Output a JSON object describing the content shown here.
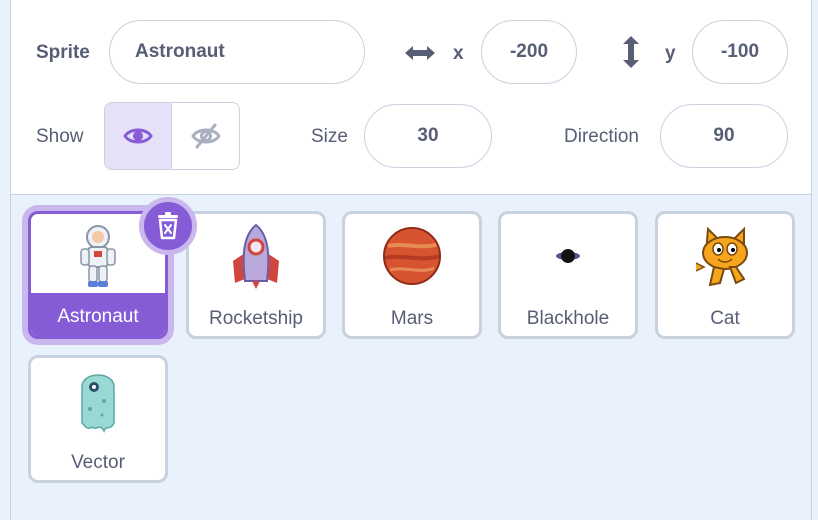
{
  "sprite_info": {
    "sprite_label": "Sprite",
    "sprite_name": "Astronaut",
    "x_label": "x",
    "x_value": "-200",
    "y_label": "y",
    "y_value": "-100",
    "show_label": "Show",
    "show_visible": true,
    "size_label": "Size",
    "size_value": "30",
    "direction_label": "Direction",
    "direction_value": "90"
  },
  "sprites": [
    {
      "name": "Astronaut",
      "selected": true,
      "icon": "astronaut-icon"
    },
    {
      "name": "Rocketship",
      "selected": false,
      "icon": "rocketship-icon"
    },
    {
      "name": "Mars",
      "selected": false,
      "icon": "mars-icon"
    },
    {
      "name": "Blackhole",
      "selected": false,
      "icon": "blackhole-icon"
    },
    {
      "name": "Cat",
      "selected": false,
      "icon": "cat-icon"
    },
    {
      "name": "Vector",
      "selected": false,
      "icon": "vector-icon"
    }
  ],
  "colors": {
    "accent": "#855cd6",
    "accent_light": "#c9b7ee",
    "text": "#575e75",
    "border": "#c8d1de",
    "background": "#e9f1fc"
  }
}
